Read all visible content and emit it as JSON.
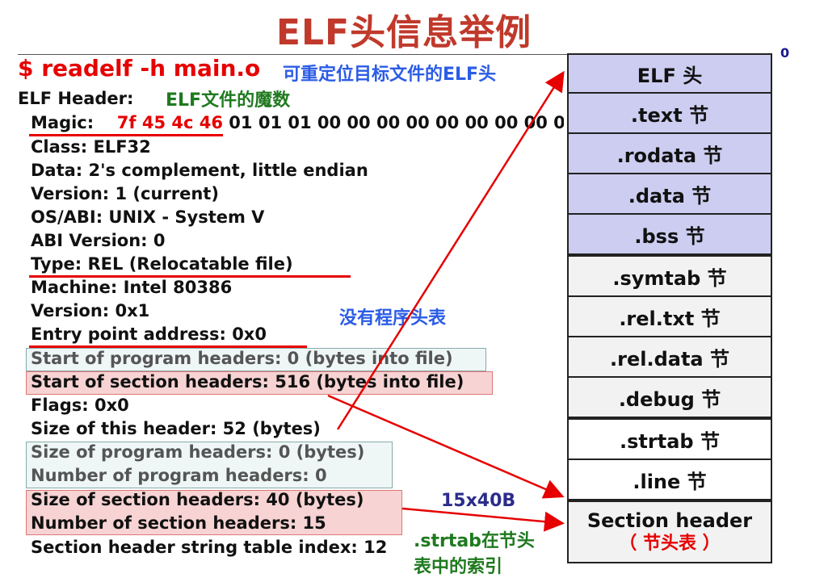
{
  "title": "ELF头信息举例",
  "command": "$ readelf -h main.o",
  "notes": {
    "relocatable": "可重定位目标文件的ELF头",
    "magic": "ELF文件的魔数",
    "no_program_header": "没有程序头表",
    "size_calc": "15x40B",
    "strtab_index_line1": ".strtab在节头",
    "strtab_index_line2": "表中的索引"
  },
  "header_label": "ELF Header:",
  "fields": {
    "magic_label": "Magic:",
    "magic_red": "7f 45 4c 46",
    "magic_rest": " 01 01 01 00 00 00 00 00 00 00 00 00",
    "class": "Class:    ELF32",
    "data": "Data:     2's complement, little endian",
    "version": "Version: 1 (current)",
    "osabi": "OS/ABI:  UNIX - System V",
    "abi_version": "ABI Version:   0",
    "type": "Type:    REL (Relocatable file)",
    "machine": "Machine:   Intel 80386",
    "version2": "Version:    0x1",
    "entry": "Entry point address:  0x0",
    "start_prog": "Start of program headers:  0 (bytes into file)",
    "start_sect": "Start of section headers:   516 (bytes into file)",
    "flags": "Flags:    0x0",
    "size_header": "Size of this header:   52 (bytes)",
    "size_prog": "Size of program headers:   0 (bytes)",
    "num_prog": "Number of program headers:   0",
    "size_sect": "Size of section headers:    40 (bytes)",
    "num_sect": "Number of section headers:  15",
    "strtab_index": "Section header string table index: 12"
  },
  "layout_marker": "0",
  "sections": [
    {
      "label": "ELF 头",
      "style": "purple"
    },
    {
      "label": ".text 节",
      "style": "purple"
    },
    {
      "label": ".rodata 节",
      "style": "purple"
    },
    {
      "label": ".data 节",
      "style": "purple"
    },
    {
      "label": ".bss 节",
      "style": "purple"
    },
    {
      "label": ".symtab 节",
      "style": "gray"
    },
    {
      "label": ".rel.txt 节",
      "style": "gray"
    },
    {
      "label": ".rel.data 节",
      "style": "gray"
    },
    {
      "label": ".debug 节",
      "style": "gray"
    },
    {
      "label": ".strtab 节",
      "style": "white"
    },
    {
      "label": ".line 节",
      "style": "white"
    }
  ],
  "section_header": {
    "label": "Section header",
    "sub": "（ 节头表 ）"
  },
  "colors": {
    "accent_red": "#e60000",
    "purple": "#cccdf0",
    "title": "#c0392b"
  }
}
